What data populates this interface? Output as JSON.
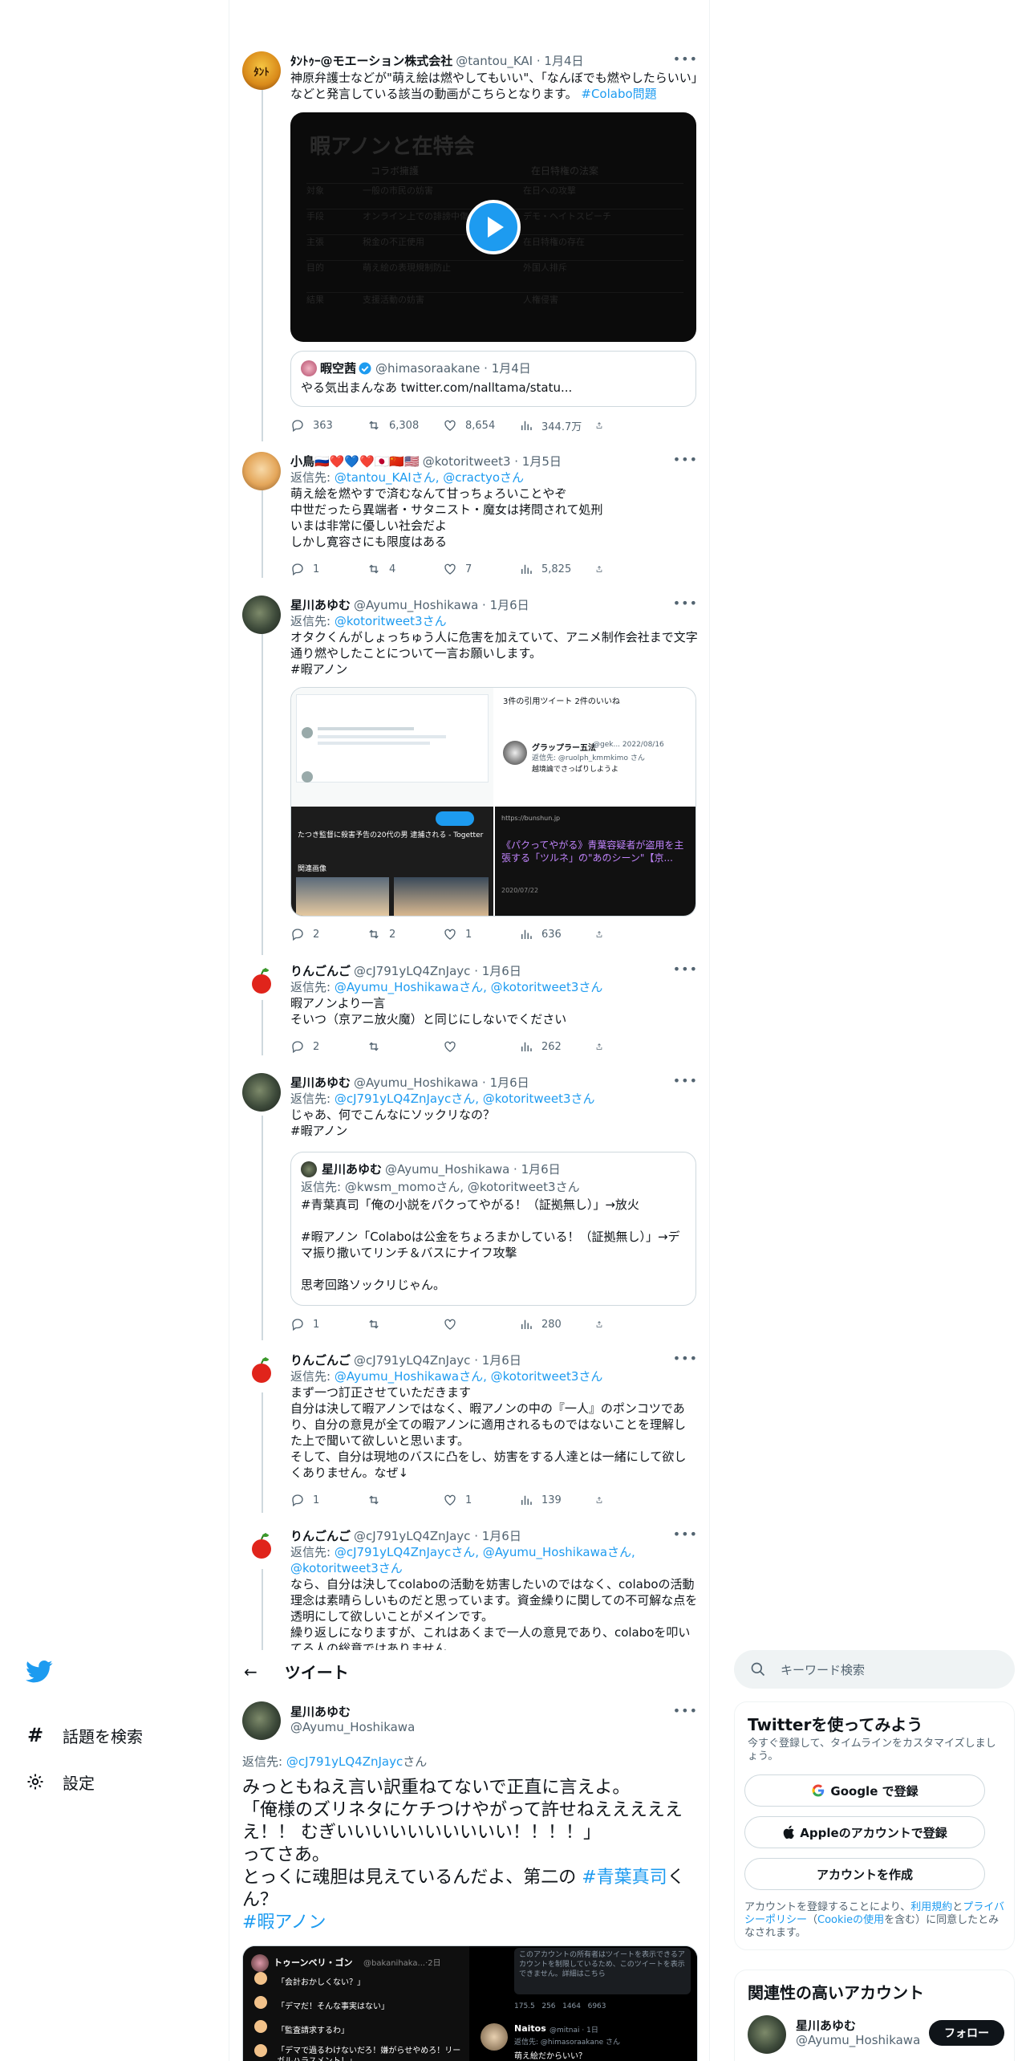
{
  "nav": {
    "explore": "話題を検索",
    "settings": "設定"
  },
  "tweets": [
    {
      "name": "ﾀﾝﾄｩｰ@モエーション株式会社",
      "handle": "@tantou_KAI · 1月4日",
      "text": "神原弁護士などが\"萌え絵は燃やしてもいい\"、「なんぼでも燃やしたらいい」などと発言している該当の動画がこちらとなります。",
      "hashtag": "#Colabo問題",
      "video": {
        "title": "暇アノンと在特会",
        "col1": "コラボ擁護",
        "col2": "在日特権の法案",
        "rows": [
          [
            "対象",
            "一般の市民の妨害",
            "在日への攻撃"
          ],
          [
            "手段",
            "オンライン上での誹謗中傷",
            "デモ・ヘイトスピーチ"
          ],
          [
            "主張",
            "税金の不正使用",
            "在日特権の存在"
          ],
          [
            "目的",
            "萌え絵の表現規制防止",
            "外国人排斥"
          ],
          [
            "結果",
            "支援活動の妨害",
            "人権侵害"
          ]
        ]
      },
      "quote": {
        "name": "暇空茜",
        "handle": "@himasoraakane · 1月4日",
        "text": "やる気出まんなあ twitter.com/nalltama/statu..."
      },
      "stats": [
        "363",
        "6,308",
        "8,654",
        "344.7万"
      ]
    },
    {
      "name": "小鳥🇷🇺❤️💙❤️🇯🇵🇨🇳🇺🇸",
      "handle": "@kotoritweet3 · 1月5日",
      "reply_prefix": "返信先: ",
      "reply_users": "@tantou_KAIさん, @cractyoさん",
      "text": "萌え絵を燃やすで済むなんて甘っちょろいことやぞ\n中世だったら異端者・サタニスト・魔女は拷問されて処刑\nいまは非常に優しい社会だよ\nしかし寛容さにも限度はある",
      "stats": [
        "1",
        "4",
        "7",
        "5,825"
      ]
    },
    {
      "name": "星川あゆむ",
      "handle": "@Ayumu_Hoshikawa · 1月6日",
      "reply_prefix": "返信先: ",
      "reply_users": "@kotoritweet3さん",
      "text": "オタクくんがしょっちゅう人に危害を加えていて、アニメ制作会社まで文字通り燃やしたことについて一言お願いします。",
      "hashtag": "#暇アノン",
      "image_card": {
        "left_title": "たつき監督に殺害予告の20代の男 逮捕される - Togetter",
        "related": "関連画像",
        "right_header": "3件の引用ツイート 2件のいいね",
        "right_user": "グラップラー五法",
        "right_handle": "@gek... 2022/08/16",
        "right_reply": "返信先: @ruolph_kmmkimo さん",
        "right_text": "越境論でさっぱりしようよ",
        "news_title": "《パクってやがる》青葉容疑者が盗用を主張する「ツルネ」の\"あのシーン\"【京...",
        "news_source": "https://bunshun.jp",
        "news_date": "2020/07/22"
      },
      "stats": [
        "2",
        "2",
        "1",
        "636"
      ]
    },
    {
      "name": "りんごんご",
      "handle": "@cJ791yLQ4ZnJayc · 1月6日",
      "reply_prefix": "返信先: ",
      "reply_users": "@Ayumu_Hoshikawaさん, @kotoritweet3さん",
      "text": "暇アノンより一言\nそいつ（京アニ放火魔）と同じにしないでください",
      "stats": [
        "2",
        "",
        "",
        "262"
      ]
    },
    {
      "name": "星川あゆむ",
      "handle": "@Ayumu_Hoshikawa · 1月6日",
      "reply_prefix": "返信先: ",
      "reply_users": "@cJ791yLQ4ZnJaycさん, @kotoritweet3さん",
      "text": "じゃあ、何でこんなにソックリなの？",
      "hashtag": "#暇アノン",
      "quote": {
        "name": "星川あゆむ",
        "handle": "@Ayumu_Hoshikawa · 1月6日",
        "reply": "返信先: @kwsm_momoさん, @kotoritweet3さん",
        "text": "#青葉真司「俺の小説をパクってやがる！（証拠無し）」→放火\n\n#暇アノン「Colaboは公金をちょろまかしている！（証拠無し）」→デマ振り撒いてリンチ＆バスにナイフ攻撃\n\n思考回路ソックリじゃん。"
      },
      "stats": [
        "1",
        "",
        "",
        "280"
      ]
    },
    {
      "name": "りんごんご",
      "handle": "@cJ791yLQ4ZnJayc · 1月6日",
      "reply_prefix": "返信先: ",
      "reply_users": "@Ayumu_Hoshikawaさん, @kotoritweet3さん",
      "text": "まず一つ訂正させていただきます\n自分は決して暇アノンではなく、暇アノンの中の『一人』のポンコツであり、自分の意見が全ての暇アノンに適用されるものではないことを理解した上で聞いて欲しいと思います。\nそして、自分は現地のバスに凸をし、妨害をする人達とは一緒にして欲しくありません。なぜ↓",
      "stats": [
        "1",
        "",
        "1",
        "139"
      ]
    },
    {
      "name": "りんごんご",
      "handle": "@cJ791yLQ4ZnJayc · 1月6日",
      "reply_prefix": "返信先: ",
      "reply_users": "@cJ791yLQ4ZnJaycさん, @Ayumu_Hoshikawaさん, @kotoritweet3さん",
      "text": "なら、自分は決してcolaboの活動を妨害したいのではなく、colaboの活動理念は素晴らしいものだと思っています。資金繰りに関しての不可解な点を透明にして欲しいことがメインです。\n繰り返しになりますが、これはあくまで一人の意見であり、colaboを叩いてる人の総意ではありません"
    }
  ],
  "main": {
    "header": "ツイート",
    "name": "星川あゆむ",
    "handle": "@Ayumu_Hoshikawa",
    "reply_prefix": "返信先: ",
    "reply_user": "@cJ791yLQ4ZnJayc",
    "reply_suffix": "さん",
    "text": "みっともねえ言い訳重ねてないで正直に言えよ。\n「俺様のズリネタにケチつけやがって許せねええええええ！！ むぎいいいいいいいいいい！！！！」\nってさあ。\nとっくに魂胆は見えているんだよ、第二の",
    "tag1": "#青葉真司",
    "text_after": "くん？",
    "tag2": "#暇アノン",
    "img_left_user": "トゥーンベリ・ゴン",
    "img_left_handle": "@bakanihaka...·2日",
    "img_left_lines": [
      "「会計おかしくない？」",
      "「デマだ！そんな事実はない」",
      "「監査請求するわ」",
      "「デマで過るわけないだろ！嫌がらせやめろ！リーガルハラスメント！」"
    ],
    "img_right_notice": "このアカウントの所有者はツイートを表示できるアカウントを制限しているため、このツイートを表示できません。詳細はこちら",
    "img_right_stats": "175.5   256   1464   6963",
    "img_right_user": "Naitos",
    "img_right_handle": "@mitnai · 1日",
    "img_right_reply": "返信先: @himasoraakane さん",
    "img_right_text": "萌え絵だからいい？"
  },
  "sidebar": {
    "search_placeholder": "キーワード検索",
    "try_title": "Twitterを使ってみよう",
    "try_desc": "今すぐ登録して、タイムラインをカスタマイズしましょう。",
    "google_btn": "Google で登録",
    "apple_btn": "Appleのアカウントで登録",
    "create_btn": "アカウントを作成",
    "terms_1": "アカウントを登録することにより、",
    "terms_link1": "利用規約",
    "terms_2": "と",
    "terms_link2": "プライバシーポリシー",
    "terms_3": "（",
    "terms_link3": "Cookieの使用",
    "terms_4": "を含む）に同意したとみなされます。",
    "related_title": "関連性の高いアカウント",
    "related_name": "星川あゆむ",
    "related_handle": "@Ayumu_Hoshikawa",
    "follow_btn": "フォロー"
  },
  "colors": {
    "accent": "#1d9bf0",
    "text": "#0f1419",
    "muted": "#536471"
  }
}
